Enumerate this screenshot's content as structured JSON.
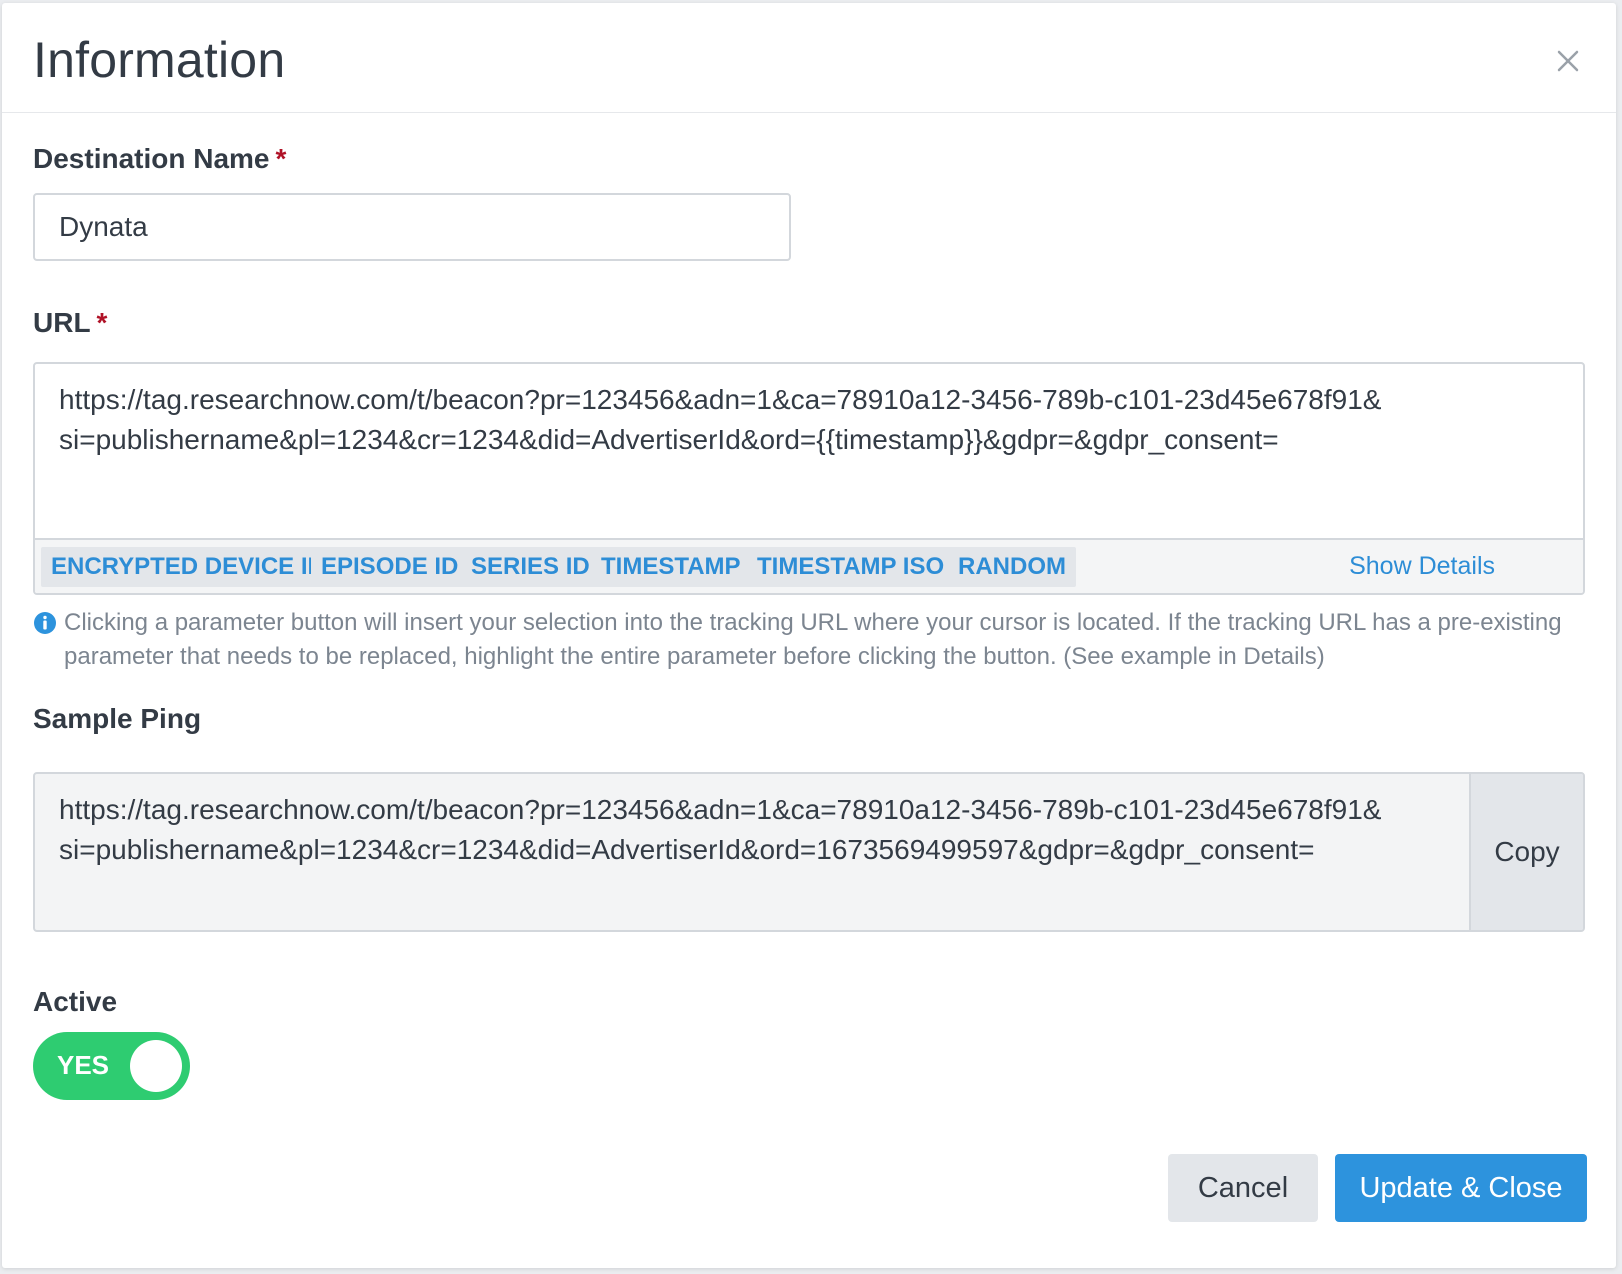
{
  "header": {
    "title": "Information",
    "close_icon": "close-icon"
  },
  "destination_name": {
    "label": "Destination Name",
    "required_mark": "*",
    "value": "Dynata"
  },
  "url": {
    "label": "URL",
    "required_mark": "*",
    "value": "https://tag.researchnow.com/t/beacon?pr=123456&adn=1&ca=78910a12-3456-789b-c101-23d45e678f91&\nsi=publishername&pl=1234&cr=1234&did=AdvertiserId&ord={{timestamp}}&gdpr=&gdpr_consent=",
    "parameters": [
      {
        "label": "ENCRYPTED DEVICE IP"
      },
      {
        "label": "EPISODE ID"
      },
      {
        "label": "SERIES ID"
      },
      {
        "label": "TIMESTAMP"
      },
      {
        "label": "TIMESTAMP ISO"
      },
      {
        "label": "RANDOM"
      }
    ],
    "show_details_label": "Show Details",
    "help_icon": "info-icon",
    "help_text": "Clicking a parameter button will insert your selection into the tracking URL where your cursor is located. If the tracking URL has a pre-existing parameter that needs to be replaced, highlight the entire parameter before clicking the button. (See example in Details)"
  },
  "sample_ping": {
    "label": "Sample Ping",
    "value": "https://tag.researchnow.com/t/beacon?pr=123456&adn=1&ca=78910a12-3456-789b-c101-23d45e678f91&\nsi=publishername&pl=1234&cr=1234&did=AdvertiserId&ord=1673569499597&gdpr=&gdpr_consent=",
    "copy_label": "Copy"
  },
  "active": {
    "label": "Active",
    "toggle_label": "YES",
    "toggle_on": true,
    "toggle_color": "#2ecc71"
  },
  "footer": {
    "cancel_label": "Cancel",
    "update_label": "Update & Close",
    "primary_color": "#2d93dd"
  }
}
